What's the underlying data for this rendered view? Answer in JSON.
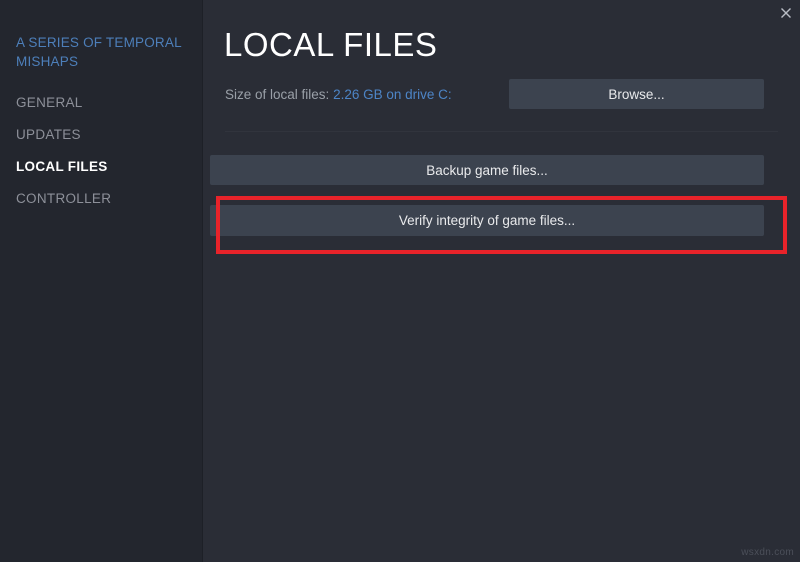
{
  "window": {
    "close_icon": "close-icon",
    "background_color": "#2a2d36",
    "sidebar_color": "#23262e"
  },
  "sidebar": {
    "game_title": "A SERIES OF TEMPORAL MISHAPS",
    "game_title_color": "#4d7fba",
    "items": [
      {
        "label": "GENERAL",
        "active": false
      },
      {
        "label": "UPDATES",
        "active": false
      },
      {
        "label": "LOCAL FILES",
        "active": true
      },
      {
        "label": "CONTROLLER",
        "active": false
      }
    ]
  },
  "main": {
    "title": "LOCAL FILES",
    "size_label": "Size of local files:",
    "size_value": "2.26 GB on drive C:",
    "size_value_color": "#4d85c7",
    "browse_label": "Browse...",
    "backup_label": "Backup game files...",
    "verify_label": "Verify integrity of game files...",
    "button_color": "#3c434f"
  },
  "annotation": {
    "highlight_color": "#e8232a",
    "target": "verify-integrity-button"
  },
  "watermark": {
    "text": "wsxdn.com"
  }
}
